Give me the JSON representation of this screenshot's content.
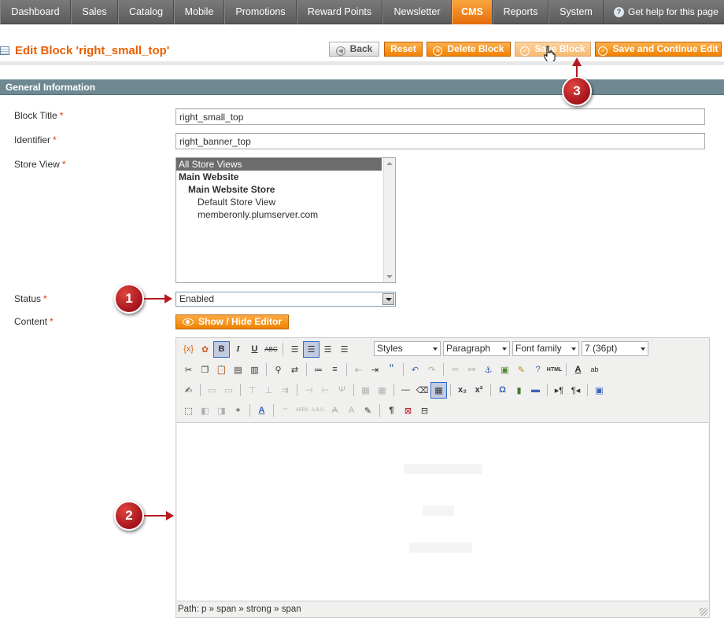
{
  "nav": {
    "items": [
      {
        "label": "Dashboard",
        "active": false
      },
      {
        "label": "Sales",
        "active": false
      },
      {
        "label": "Catalog",
        "active": false
      },
      {
        "label": "Mobile",
        "active": false
      },
      {
        "label": "Promotions",
        "active": false
      },
      {
        "label": "Reward Points",
        "active": false
      },
      {
        "label": "Newsletter",
        "active": false
      },
      {
        "label": "CMS",
        "active": true
      },
      {
        "label": "Reports",
        "active": false
      },
      {
        "label": "System",
        "active": false
      }
    ],
    "help_label": "Get help for this page",
    "help_icon": "question-circle-icon"
  },
  "header": {
    "title": "Edit Block 'right_small_top'",
    "title_icon": "grid-table-icon",
    "buttons": {
      "back": "Back",
      "reset": "Reset",
      "delete": "Delete Block",
      "save": "Save Block",
      "save_continue": "Save and Continue Edit"
    }
  },
  "section": {
    "title": "General Information"
  },
  "form": {
    "block_title": {
      "label": "Block Title",
      "required": "*",
      "value": "right_small_top"
    },
    "identifier": {
      "label": "Identifier",
      "required": "*",
      "value": "right_banner_top"
    },
    "store_view": {
      "label": "Store View",
      "required": "*",
      "options": [
        {
          "label": "All Store Views",
          "selected": true
        },
        {
          "label": "Main Website"
        },
        {
          "label": "Main Website Store"
        },
        {
          "label": "Default Store View"
        },
        {
          "label": "memberonly.plumserver.com"
        }
      ]
    },
    "status": {
      "label": "Status",
      "required": "*",
      "value": "Enabled"
    },
    "content": {
      "label": "Content",
      "required": "*",
      "toggle_label": "Show / Hide Editor"
    }
  },
  "editor": {
    "styles_select": "Styles",
    "format_select": "Paragraph",
    "font_family_select": "Font family",
    "font_size_select": "7 (36pt)",
    "path": "Path: p » span » strong » span"
  },
  "callouts": [
    "1",
    "2",
    "3"
  ],
  "colors": {
    "accent": "#eb5e00",
    "button_orange": "#f18200",
    "section_header": "#6f8992",
    "callout_red": "#b61a1f"
  }
}
